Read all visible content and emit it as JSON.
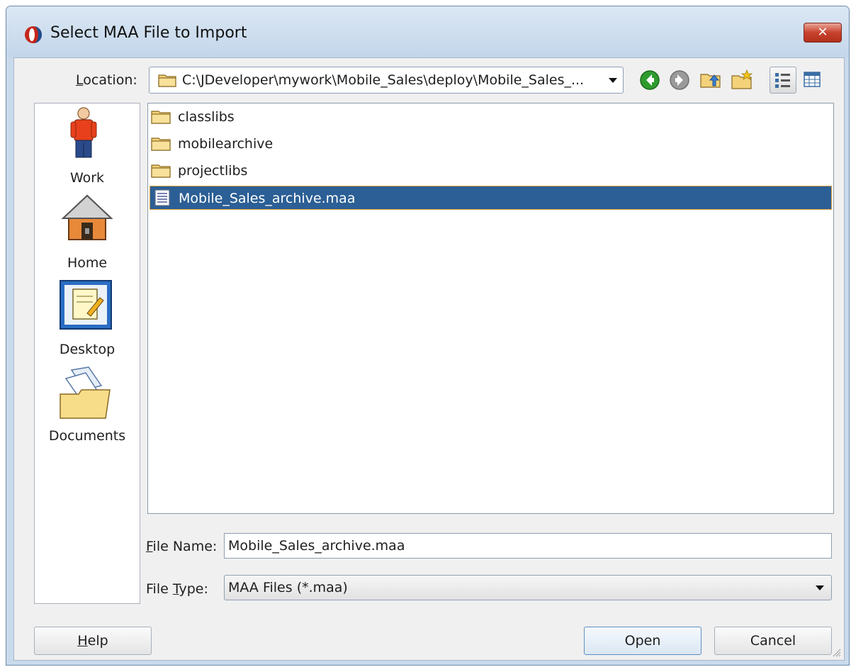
{
  "window": {
    "title": "Select MAA File to Import",
    "close_label": "✕",
    "icons": {
      "app": "jdeveloper-app-icon",
      "close": "close-icon"
    }
  },
  "toolbar": {
    "location_label_mnemonic": "L",
    "location_label_rest": "ocation:",
    "location_path": "C:\\JDeveloper\\mywork\\Mobile_Sales\\deploy\\Mobile_Sales_...",
    "buttons": [
      "back-icon",
      "forward-icon",
      "up-folder-icon",
      "new-folder-icon",
      "list-view-icon",
      "details-view-icon"
    ]
  },
  "places": [
    {
      "label": "Work",
      "icon": "work-person-icon"
    },
    {
      "label": "Home",
      "icon": "home-icon"
    },
    {
      "label": "Desktop",
      "icon": "desktop-icon"
    },
    {
      "label": "Documents",
      "icon": "documents-icon"
    }
  ],
  "files": [
    {
      "name": "classlibs",
      "type": "folder",
      "selected": false
    },
    {
      "name": "mobilearchive",
      "type": "folder",
      "selected": false
    },
    {
      "name": "projectlibs",
      "type": "folder",
      "selected": false
    },
    {
      "name": "Mobile_Sales_archive.maa",
      "type": "file",
      "selected": true
    }
  ],
  "form": {
    "file_name_label_mnemonic": "F",
    "file_name_label_rest": "ile Name:",
    "file_name_value": "Mobile_Sales_archive.maa",
    "file_type_label_start": "File ",
    "file_type_label_mnemonic": "T",
    "file_type_label_rest": "ype:",
    "file_type_value": "MAA Files (*.maa)"
  },
  "buttons": {
    "help_mnemonic": "H",
    "help_rest": "elp",
    "open": "Open",
    "cancel": "Cancel"
  },
  "colors": {
    "selection": "#2b5f95",
    "selection_border": "#e6a23c",
    "title_bar": "#c9daec",
    "close_button": "#c8422d"
  }
}
